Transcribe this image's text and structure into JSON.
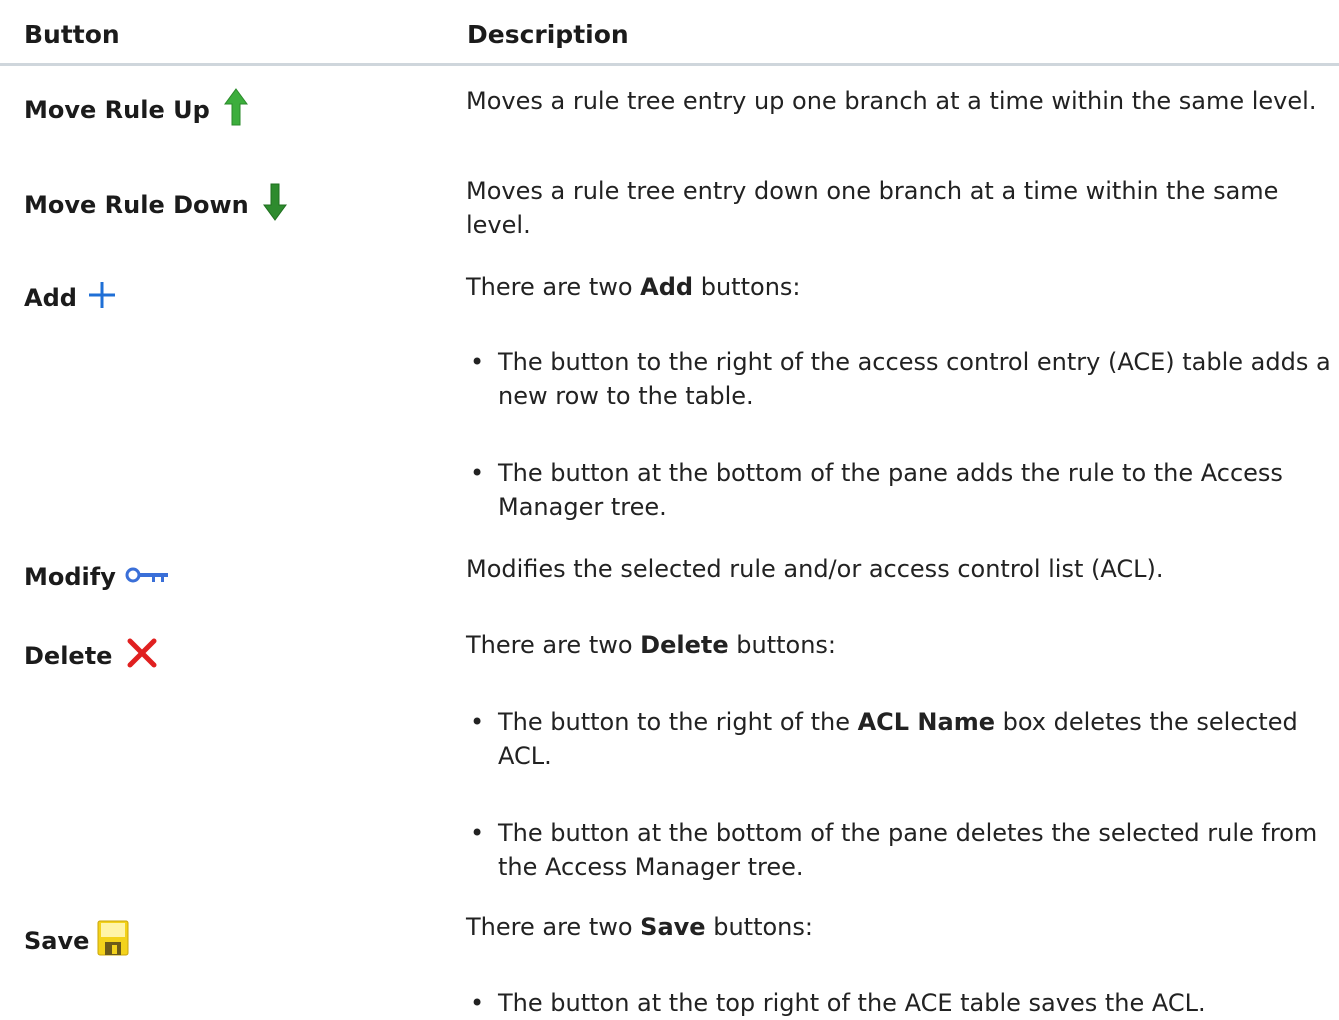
{
  "table": {
    "headers": {
      "button": "Button",
      "description": "Description"
    },
    "rows": [
      {
        "name": "Move Rule Up",
        "icon": "arrow-up-icon",
        "desc": "Moves a rule tree entry up one branch at a time within the same level."
      },
      {
        "name": "Move Rule Down",
        "icon": "arrow-down-icon",
        "desc": "Moves a rule tree entry down one branch at a time within the same level."
      },
      {
        "name": "Add",
        "icon": "plus-icon",
        "desc_pre": "There are two ",
        "desc_bold": "Add",
        "desc_post": " buttons:",
        "bullets": [
          "The button to the right of the access control entry (ACE) table adds a new row to the table.",
          "The button at the bottom of the pane adds the rule to the Access Manager tree."
        ]
      },
      {
        "name": "Modify",
        "icon": "key-icon",
        "desc": "Modifies the selected rule and/or access control list (ACL)."
      },
      {
        "name": "Delete",
        "icon": "x-icon",
        "desc_pre": "There are two ",
        "desc_bold": "Delete",
        "desc_post": " buttons:",
        "bullets": [
          {
            "pre": "The button to the right of the ",
            "bold": "ACL Name",
            "post": " box deletes the selected ACL."
          },
          "The button at the bottom of the pane deletes the selected rule from the Access Manager tree."
        ]
      },
      {
        "name": "Save",
        "icon": "floppy-disk-icon",
        "desc_pre": "There are two ",
        "desc_bold": "Save",
        "desc_post": " buttons:",
        "bullets": [
          "The button at the top right of the ACE table saves the ACL."
        ]
      }
    ]
  },
  "colors": {
    "up_arrow": "#3cae3c",
    "down_arrow": "#2e8b2e",
    "plus": "#1f6fd6",
    "key": "#3a6fd8",
    "delete": "#e02020",
    "save": "#f3d21b",
    "header_rule": "#cfd6dc"
  }
}
